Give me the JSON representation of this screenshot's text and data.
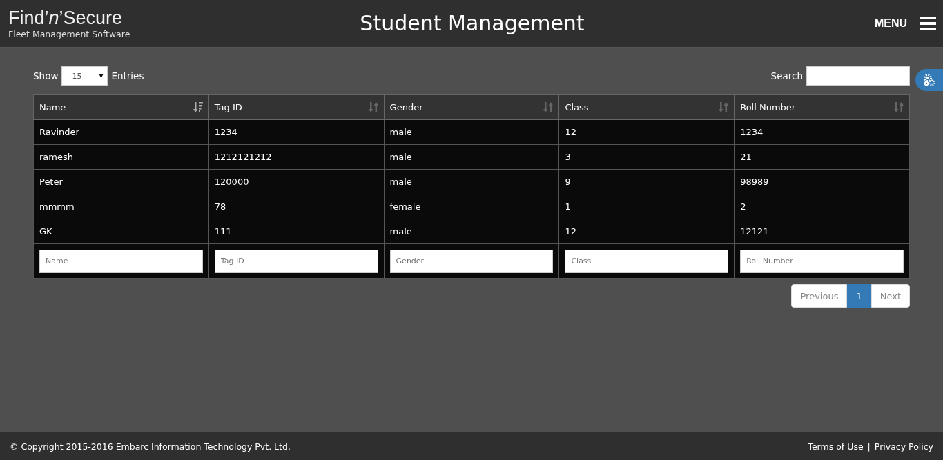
{
  "header": {
    "logo": "Find’*n*’Secure",
    "tagline": "Fleet Management Software",
    "title": "Student Management",
    "menu_label": "MENU"
  },
  "controls": {
    "show_label": "Show",
    "page_size": "15",
    "entries_label": "Entries",
    "search_label": "Search"
  },
  "table": {
    "columns": [
      {
        "label": "Name",
        "sorted": true
      },
      {
        "label": "Tag ID",
        "sorted": false
      },
      {
        "label": "Gender",
        "sorted": false
      },
      {
        "label": "Class",
        "sorted": false
      },
      {
        "label": "Roll Number",
        "sorted": false
      }
    ],
    "rows": [
      [
        "Ravinder",
        "1234",
        "male",
        "12",
        "1234"
      ],
      [
        "ramesh",
        "1212121212",
        "male",
        "3",
        "21"
      ],
      [
        "Peter",
        "120000",
        "male",
        "9",
        "98989"
      ],
      [
        "mmmm",
        "78",
        "female",
        "1",
        "2"
      ],
      [
        "GK",
        "111",
        "male",
        "12",
        "12121"
      ]
    ],
    "filters": [
      {
        "placeholder": "Name"
      },
      {
        "placeholder": "Tag ID"
      },
      {
        "placeholder": "Gender"
      },
      {
        "placeholder": "Class"
      },
      {
        "placeholder": "Roll Number"
      }
    ]
  },
  "pagination": [
    {
      "label": "Previous",
      "selected": false
    },
    {
      "label": "1",
      "selected": true
    },
    {
      "label": "Next",
      "selected": false
    }
  ],
  "footer": {
    "copyright": "© Copyright 2015-2016 Embarc Information Technology Pvt. Ltd.",
    "links": [
      "Terms of Use",
      "Privacy Policy"
    ],
    "separator": "|"
  }
}
